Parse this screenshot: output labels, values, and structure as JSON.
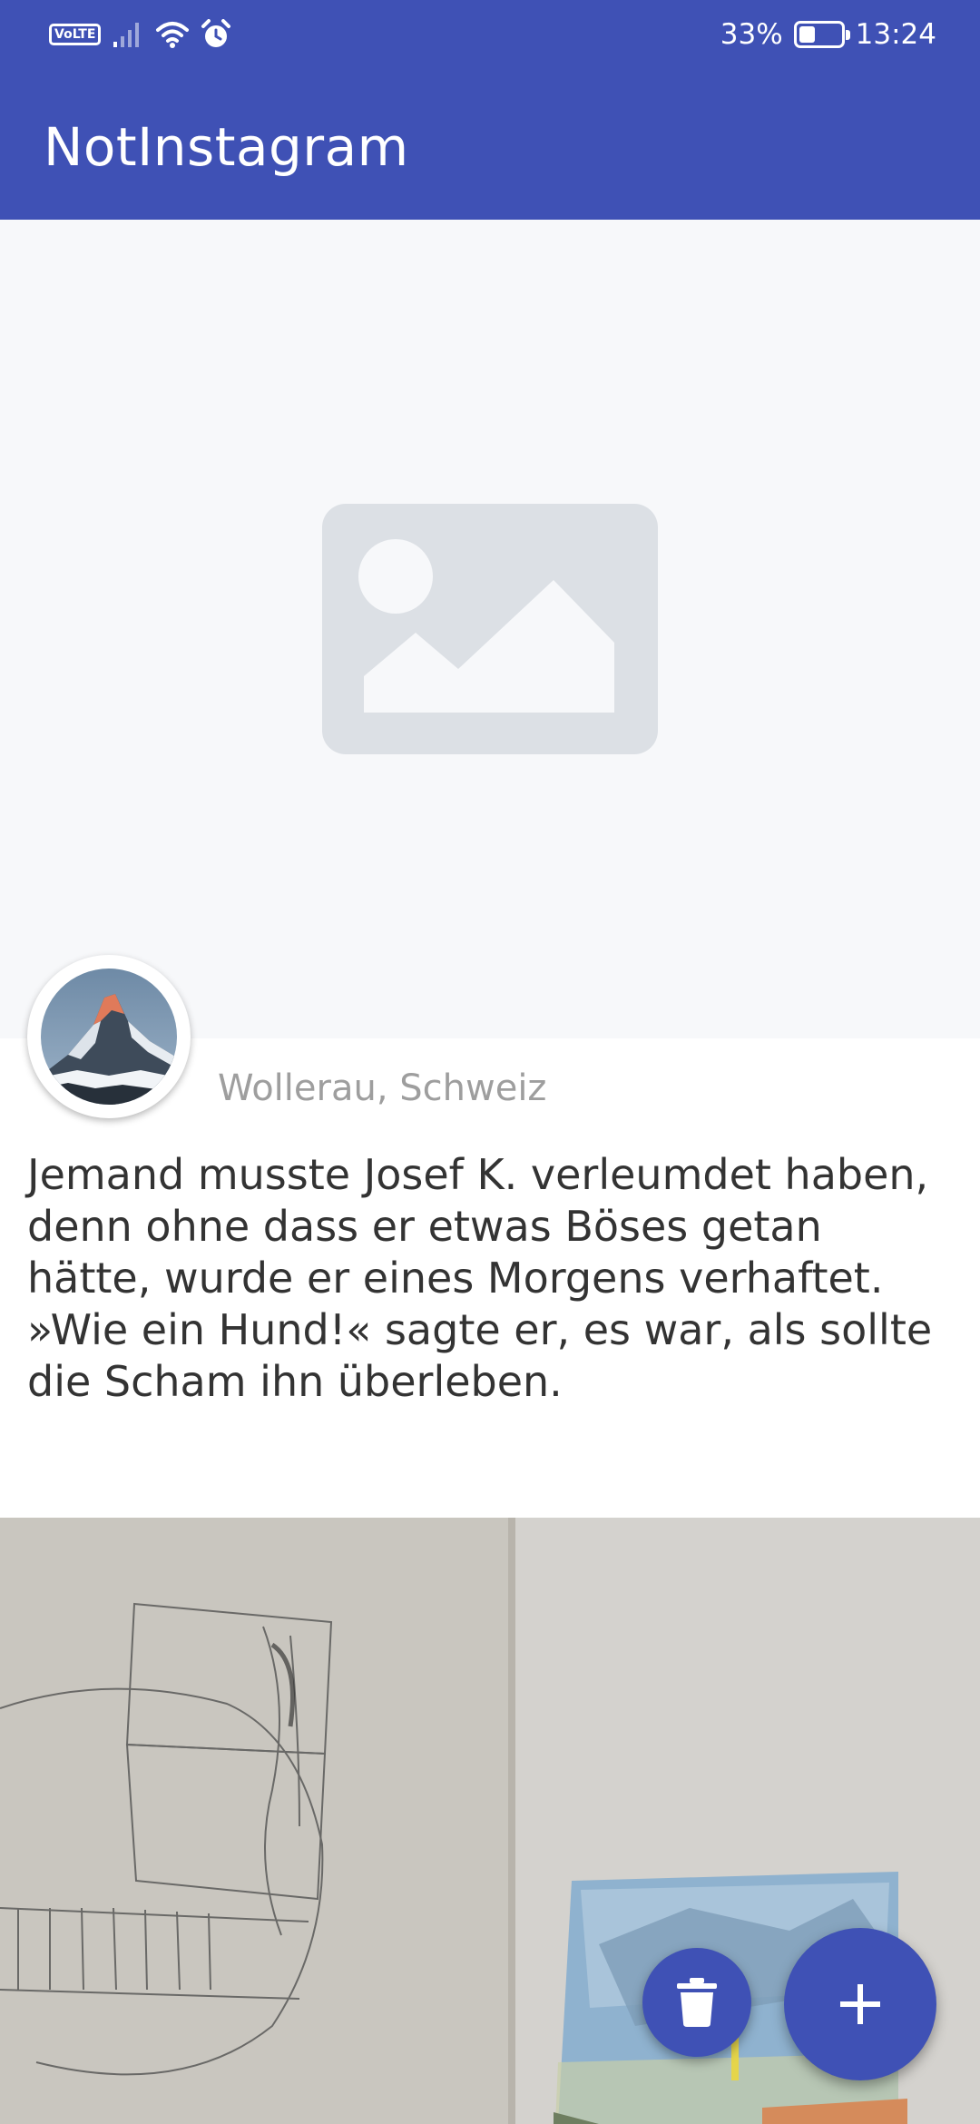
{
  "status_bar": {
    "network_badge": "VoLTE",
    "battery_percent": "33%",
    "time": "13:24",
    "battery_level": 0.33,
    "icons": [
      "volte-icon",
      "signal-icon",
      "wifi-icon",
      "alarm-icon",
      "battery-icon"
    ]
  },
  "app_bar": {
    "title": "NotInstagram",
    "color": "#3F51B5"
  },
  "posts": [
    {
      "image": "image-placeholder-icon",
      "avatar": "mountain-avatar",
      "location": "Wollerau, Schweiz",
      "caption": "Jemand musste Josef K. verleumdet haben, denn ohne dass er etwas Böses getan hätte, wurde er eines Morgens verhaftet. »Wie ein Hund!« sagte er, es war, als sollte die Scham ihn überleben."
    },
    {
      "image": "artwork-photo"
    }
  ],
  "fabs": {
    "delete": "trash-icon",
    "add": "plus-icon",
    "accent": "#3F51B5"
  }
}
